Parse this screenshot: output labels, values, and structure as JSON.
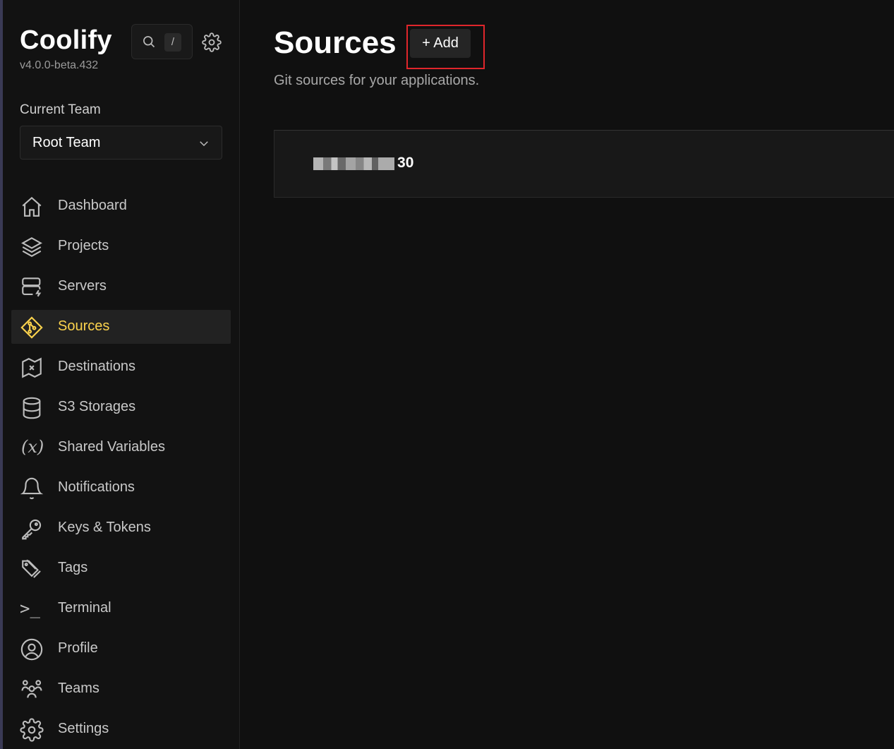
{
  "app": {
    "name": "Coolify",
    "version": "v4.0.0-beta.432"
  },
  "search": {
    "shortcut": "/"
  },
  "team": {
    "label": "Current Team",
    "selected": "Root Team"
  },
  "nav": {
    "items": [
      {
        "label": "Dashboard",
        "icon": "home-icon"
      },
      {
        "label": "Projects",
        "icon": "layers-icon"
      },
      {
        "label": "Servers",
        "icon": "server-icon"
      },
      {
        "label": "Sources",
        "icon": "git-icon",
        "active": true
      },
      {
        "label": "Destinations",
        "icon": "map-icon"
      },
      {
        "label": "S3 Storages",
        "icon": "database-icon"
      },
      {
        "label": "Shared Variables",
        "icon": "variable-icon",
        "glyph": "(x)"
      },
      {
        "label": "Notifications",
        "icon": "bell-icon"
      },
      {
        "label": "Keys & Tokens",
        "icon": "key-icon"
      },
      {
        "label": "Tags",
        "icon": "tag-icon"
      },
      {
        "label": "Terminal",
        "icon": "terminal-icon",
        "glyph": ">_"
      },
      {
        "label": "Profile",
        "icon": "user-circle-icon"
      },
      {
        "label": "Teams",
        "icon": "users-icon"
      },
      {
        "label": "Settings",
        "icon": "gear-icon"
      }
    ]
  },
  "main": {
    "title": "Sources",
    "add_label": "+ Add",
    "subtitle": "Git sources for your applications.",
    "sources": [
      {
        "name_hidden": "████████",
        "name_visible": "30"
      }
    ]
  },
  "colors": {
    "accent": "#fcd34d",
    "background": "#101010",
    "highlight_box": "#e0262b"
  }
}
